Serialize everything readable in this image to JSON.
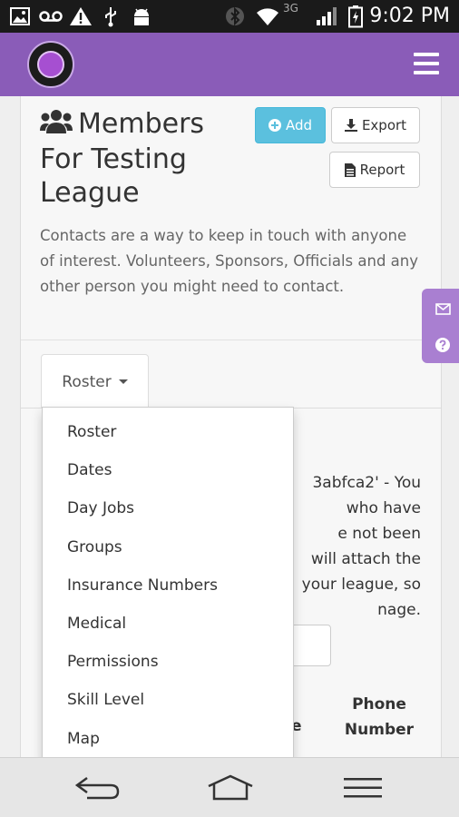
{
  "status_bar": {
    "time": "9:02 PM",
    "network": "3G",
    "icons": [
      "image-icon",
      "voicemail-icon",
      "warning-icon",
      "usb-icon",
      "android-debug-icon",
      "bluetooth-icon",
      "wifi-icon",
      "signal-icon",
      "battery-icon"
    ]
  },
  "header": {
    "logo": "league-logo",
    "menu_icon": "hamburger-icon",
    "colors": {
      "background": "#8a5cb8"
    }
  },
  "page": {
    "title": "Members For Testing League",
    "title_icon": "users-icon",
    "description": "Contacts are a way to keep in touch with anyone of interest. Volunteers, Sponsors, Officials and any other person you might need to contact."
  },
  "toolbar": {
    "add_label": "Add",
    "export_label": "Export",
    "report_label": "Report",
    "colors": {
      "add_button": "#5bc0de"
    }
  },
  "tabs": {
    "selected_label": "Roster"
  },
  "dropdown": {
    "items": [
      "Roster",
      "Dates",
      "Day Jobs",
      "Groups",
      "Insurance Numbers",
      "Medical",
      "Permissions",
      "Skill Level",
      "Map"
    ]
  },
  "background": {
    "lines": [
      "3abfca2' - You",
      "who have",
      "e not been",
      "will attach the",
      "your league, so",
      "nage."
    ],
    "col_head": "Phone Number",
    "col_head_partial": "e"
  },
  "side_tab": {
    "icons": [
      "envelope-icon",
      "question-icon"
    ],
    "colors": {
      "background": "#a97fd1"
    }
  },
  "nav_bar": {
    "buttons": [
      "back-icon",
      "home-icon",
      "recent-apps-icon"
    ]
  }
}
